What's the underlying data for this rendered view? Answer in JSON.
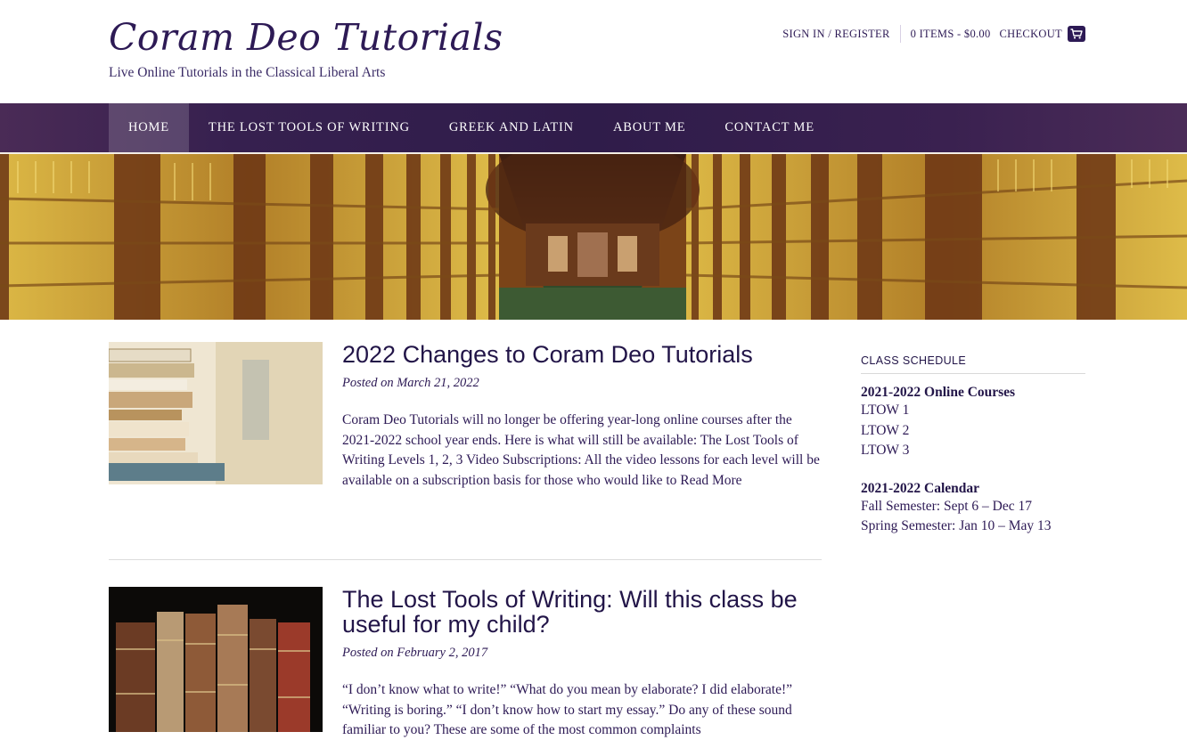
{
  "header": {
    "site_title": "Coram Deo Tutorials",
    "tagline": "Live Online Tutorials in the Classical Liberal Arts",
    "sign_in": "SIGN IN / REGISTER",
    "cart_summary": "0 ITEMS - $0.00",
    "checkout": "CHECKOUT"
  },
  "nav": {
    "items": [
      {
        "label": "HOME"
      },
      {
        "label": "THE LOST TOOLS OF WRITING"
      },
      {
        "label": "GREEK AND LATIN"
      },
      {
        "label": "ABOUT ME"
      },
      {
        "label": "CONTACT ME"
      }
    ]
  },
  "posts": [
    {
      "title": "2022 Changes to Coram Deo Tutorials",
      "date": "Posted on March 21, 2022",
      "excerpt": "Coram Deo Tutorials will no longer be offering year-long online courses after the 2021-2022 school year ends. Here is what will still be available: The Lost Tools of Writing Levels 1, 2, 3 Video Subscriptions: All the video lessons for each level will be available on a subscription basis for those who would like to",
      "read_more": "Read More"
    },
    {
      "title": "The Lost Tools of Writing: Will this class be useful for my child?",
      "date": "Posted on February 2, 2017",
      "excerpt": "“I don’t know what to write!” “What do you mean by elaborate? I did elaborate!” “Writing is boring.” “I don’t know how to start my essay.”  Do any of these sound familiar to you? These are some of the most common complaints"
    }
  ],
  "sidebar": {
    "widget_title": "CLASS SCHEDULE",
    "courses_heading": "2021-2022 Online Courses",
    "courses": [
      "LTOW 1",
      "LTOW 2",
      "LTOW 3"
    ],
    "calendar_heading": "2021-2022 Calendar",
    "calendar": [
      "Fall Semester: Sept 6 – Dec 17",
      "Spring Semester: Jan 10 – May 13"
    ]
  },
  "colors": {
    "brand": "#2d1a55",
    "nav_bg": "#36204f",
    "hero_gold": "#c8a23a"
  },
  "icons": {
    "cart": "cart-icon"
  }
}
